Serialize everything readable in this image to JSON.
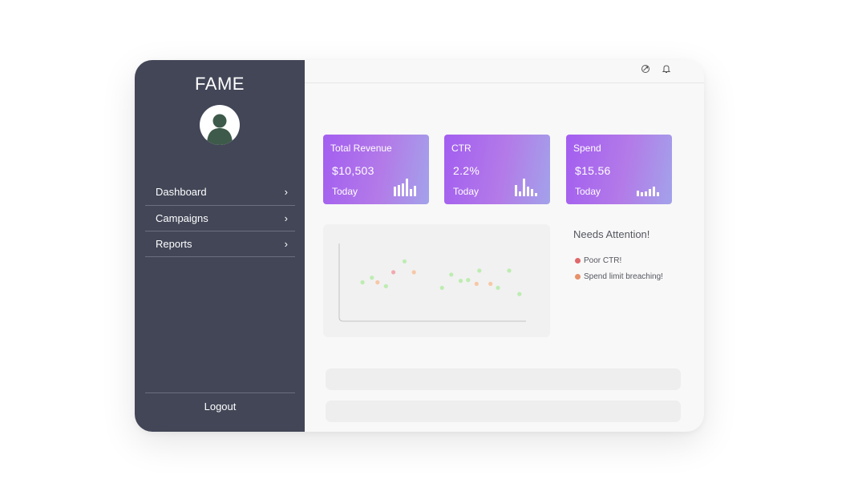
{
  "sidebar": {
    "brand": "FAME",
    "nav": [
      {
        "label": "Dashboard",
        "arrow": "›"
      },
      {
        "label": "Campaigns",
        "arrow": "›"
      },
      {
        "label": "Reports",
        "arrow": "›"
      }
    ],
    "logout_label": "Logout"
  },
  "topbar": {
    "icons": [
      "refresh-icon",
      "bell-icon"
    ]
  },
  "cards": [
    {
      "title": "Total Revenue",
      "value": "$10,503",
      "period": "Today"
    },
    {
      "title": "CTR",
      "value": "2.2%",
      "period": "Today"
    },
    {
      "title": "Spend",
      "value": "$15.56",
      "period": "Today"
    }
  ],
  "attention": {
    "title": "Needs Attention!",
    "items": [
      {
        "label": "Poor CTR!",
        "color": "#e0686a"
      },
      {
        "label": "Spend limit breaching!",
        "color": "#e8906a"
      }
    ]
  },
  "chart_data": {
    "type": "scatter",
    "title": "",
    "xlabel": "",
    "ylabel": "",
    "xlim": [
      0,
      20
    ],
    "ylim": [
      0,
      10
    ],
    "grid": false,
    "series": [
      {
        "color": "#bdecb1",
        "points": [
          [
            2.5,
            5
          ],
          [
            3.5,
            5.6
          ],
          [
            5,
            4.5
          ],
          [
            7,
            7.7
          ],
          [
            11,
            4.3
          ],
          [
            12,
            6
          ],
          [
            13,
            5.2
          ],
          [
            13.8,
            5.3
          ],
          [
            15,
            6.5
          ],
          [
            17,
            4.3
          ],
          [
            18.2,
            6.5
          ],
          [
            19.3,
            3.5
          ]
        ]
      },
      {
        "color": "#f7c8a6",
        "points": [
          [
            4.1,
            5
          ],
          [
            8,
            6.3
          ],
          [
            14.7,
            4.8
          ],
          [
            16.2,
            4.8
          ]
        ]
      },
      {
        "color": "#f2a9ae",
        "points": [
          [
            5.8,
            6.3
          ]
        ]
      }
    ]
  },
  "colors": {
    "sidebar": "#424657",
    "card_gradient_start": "#a35ef0",
    "card_gradient_end": "#a3a2ea",
    "avatar_figure": "#3e5a4a"
  }
}
